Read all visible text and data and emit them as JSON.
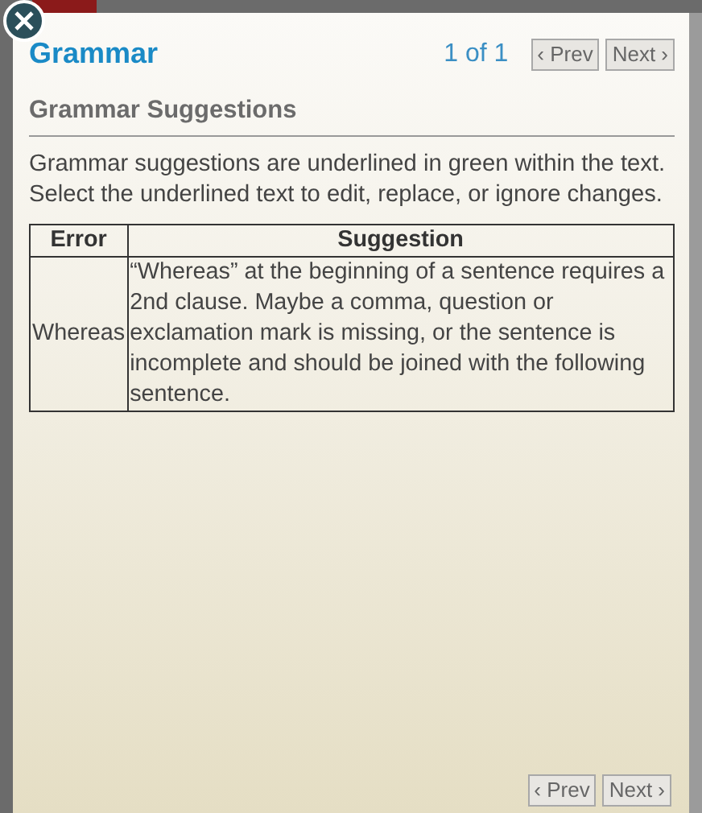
{
  "panel": {
    "title": "Grammar",
    "counter": "1 of 1",
    "nav_top": [
      {
        "label": "‹ Prev",
        "disabled": true
      },
      {
        "label": "Next ›",
        "disabled": true
      }
    ],
    "section_heading": "Grammar Suggestions",
    "intro": "Grammar suggestions are underlined in green within the text. Select the underlined text to edit, replace, or ignore changes.",
    "table": {
      "columns": [
        "Error",
        "Suggestion"
      ],
      "rows": [
        {
          "error": "Whereas",
          "suggestion": "“Whereas” at the beginning of a sentence requires a 2nd clause. Maybe a comma, question or exclamation mark is missing, or the sentence is incomplete and should be joined with the following sentence."
        }
      ]
    },
    "nav_bottom": [
      {
        "label": "‹ Prev",
        "disabled": true
      },
      {
        "label": "Next ›",
        "disabled": true
      }
    ]
  }
}
